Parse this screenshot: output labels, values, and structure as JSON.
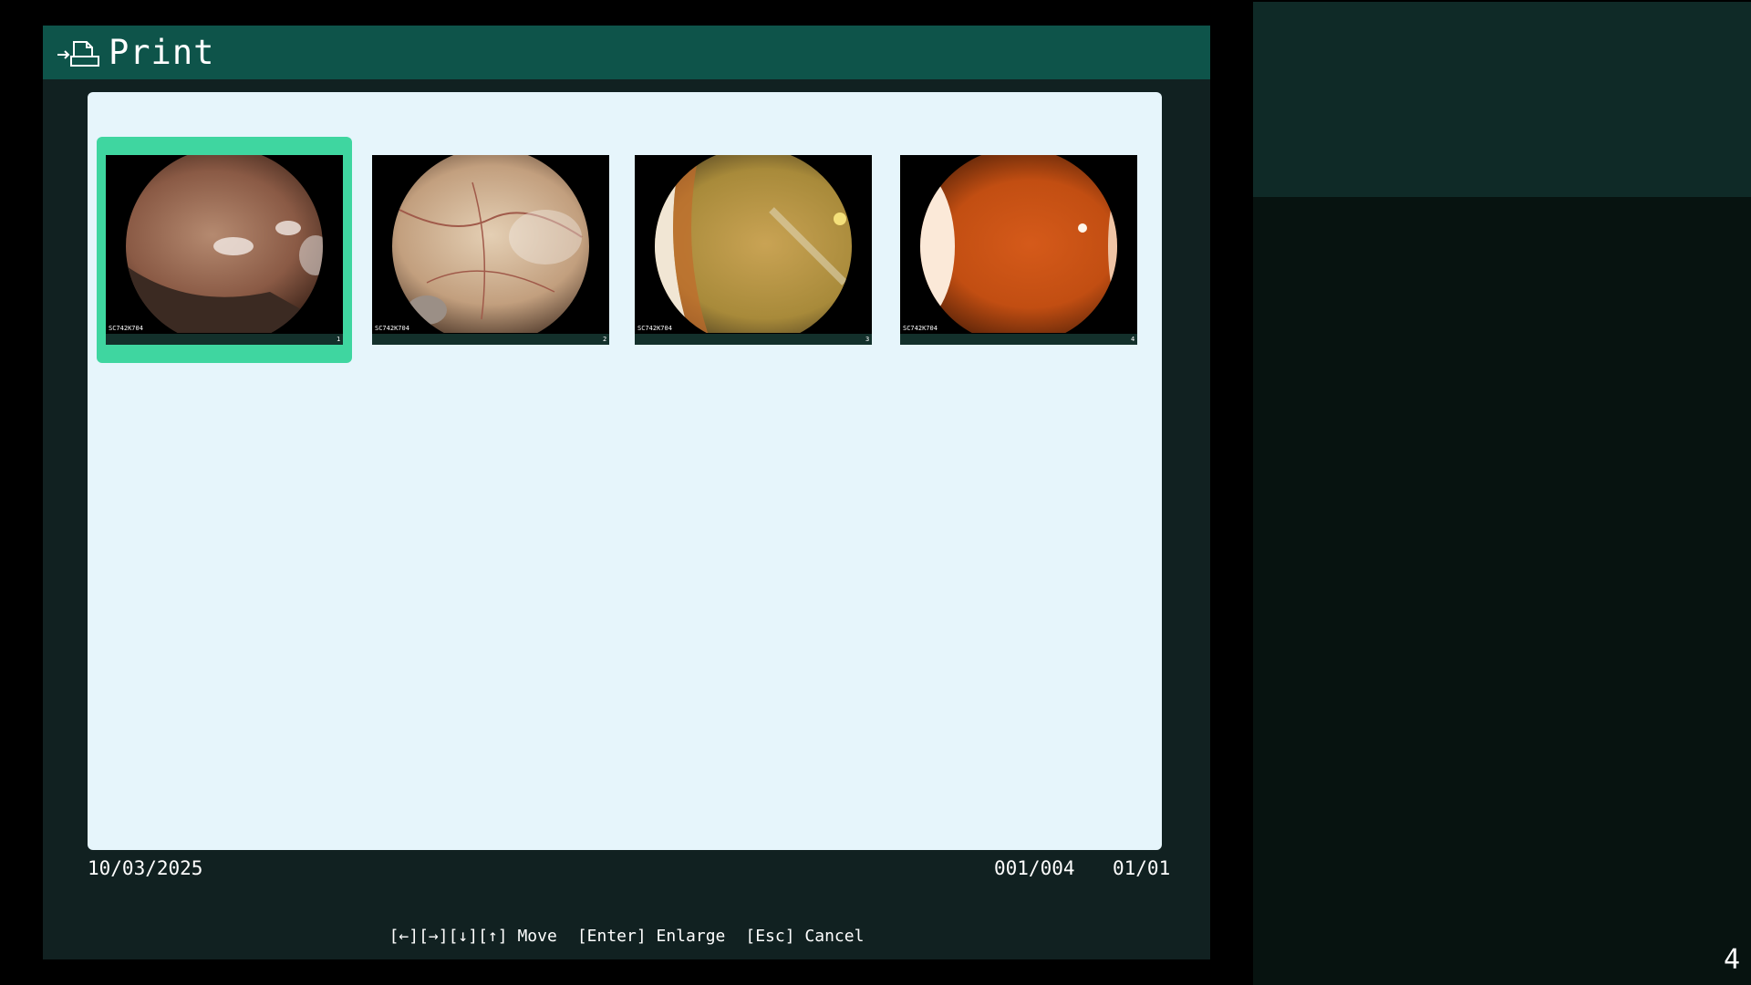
{
  "dialog": {
    "title": "Print",
    "icon": "print-to-file-icon"
  },
  "thumbnails": [
    {
      "index": "1",
      "label": "SC742K704",
      "selected": true
    },
    {
      "index": "2",
      "label": "SC742K704",
      "selected": false
    },
    {
      "index": "3",
      "label": "SC742K704",
      "selected": false
    },
    {
      "index": "4",
      "label": "SC742K704",
      "selected": false
    }
  ],
  "footer": {
    "date": "10/03/2025",
    "count": "001/004",
    "page": "01/01"
  },
  "hints": {
    "move": "[←][→][↓][↑] Move",
    "enlarge": "[Enter] Enlarge",
    "cancel": "[Esc] Cancel"
  },
  "side": {
    "number": "4"
  },
  "colors": {
    "titlebar": "#0e544a",
    "selection": "#3fd6a0",
    "panel": "#e6f5fb",
    "dialog_bg": "#112121"
  }
}
